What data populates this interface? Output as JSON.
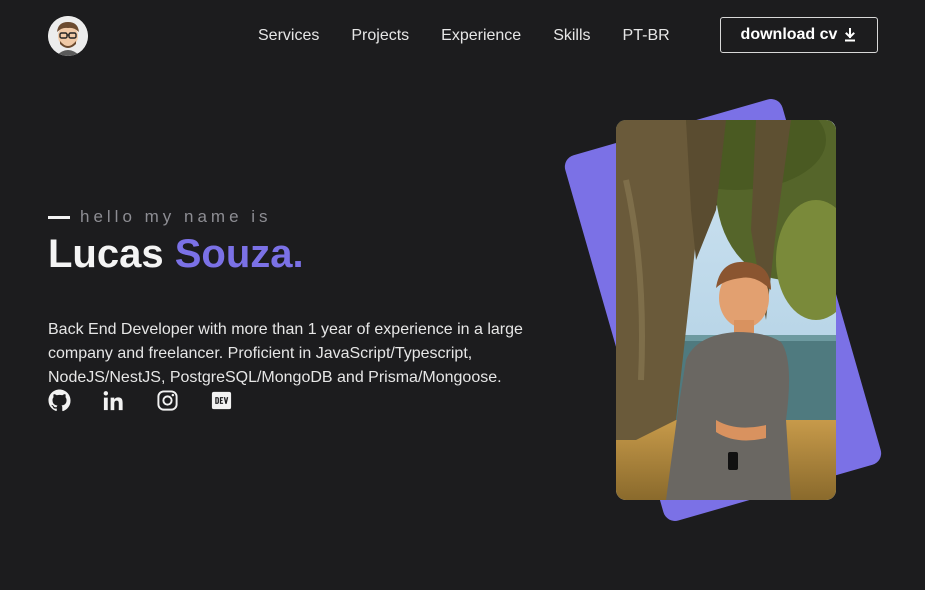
{
  "header": {
    "logo_icon": "avatar-icon",
    "nav": [
      {
        "label": "Services"
      },
      {
        "label": "Projects"
      },
      {
        "label": "Experience"
      },
      {
        "label": "Skills"
      },
      {
        "label": "PT-BR"
      }
    ],
    "cv_button": {
      "label": "download cv",
      "icon": "download-icon"
    }
  },
  "hero": {
    "greeting": "hello my name is",
    "first_name": "Lucas",
    "last_name": "Souza.",
    "bio": "Back End Developer with more than 1 year of experience in a large company and freelancer. Proficient in JavaScript/Typescript, NodeJS/NestJS, PostgreSQL/MongoDB and Prisma/Mongoose.",
    "socials": [
      {
        "icon": "github-icon"
      },
      {
        "icon": "linkedin-icon"
      },
      {
        "icon": "instagram-icon"
      },
      {
        "icon": "dev-to-icon"
      }
    ]
  },
  "colors": {
    "background": "#1c1c1e",
    "accent": "#7b71e6",
    "text": "#f2f2f2",
    "muted": "#8d8d93"
  }
}
